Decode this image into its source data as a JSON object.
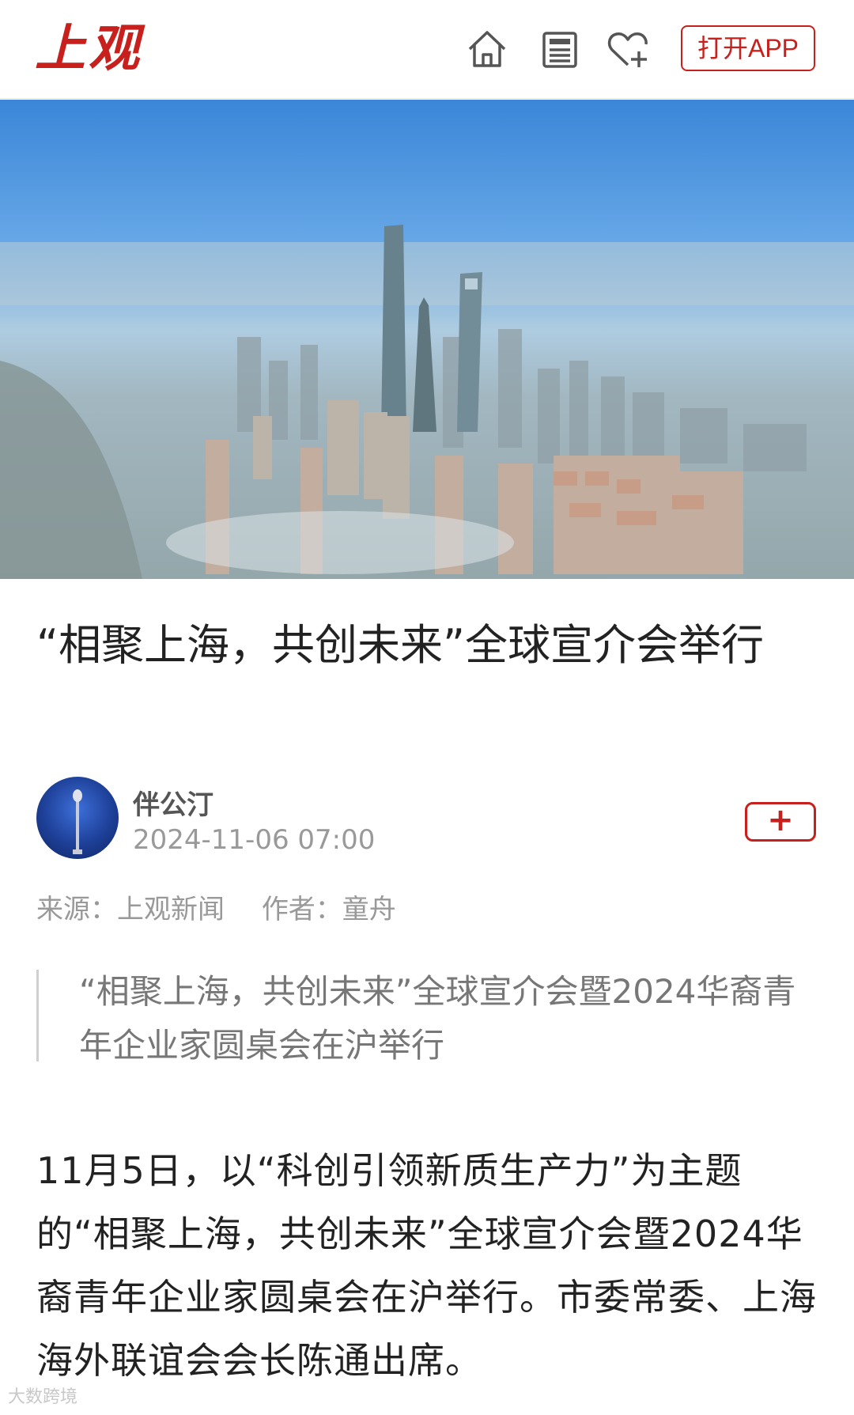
{
  "header": {
    "logo": "上观",
    "open_app_label": "打开APP",
    "icons": [
      "home-icon",
      "news-icon",
      "favorite-add-icon"
    ]
  },
  "article": {
    "title": "“相聚上海，共创未来”全球宣介会举行",
    "author": {
      "name": "伴公汀",
      "date": "2024-11-06 07:00",
      "follow_label": "+"
    },
    "source_label": "来源：上观新闻",
    "author_label": "作者：童舟",
    "summary": "“相聚上海，共创未来”全球宣介会暨2024华裔青年企业家圆桌会在沪举行",
    "body": "11月5日，以“科创引领新质生产力”为主题的“相聚上海，共创未来”全球宣介会暨2024华裔青年企业家圆桌会在沪举行。市委常委、上海海外联谊会会长陈通出席。"
  },
  "watermark": "大数跨境",
  "colors": {
    "brand_red": "#c8211d",
    "text_dark": "#222222",
    "text_gray": "#999999"
  }
}
